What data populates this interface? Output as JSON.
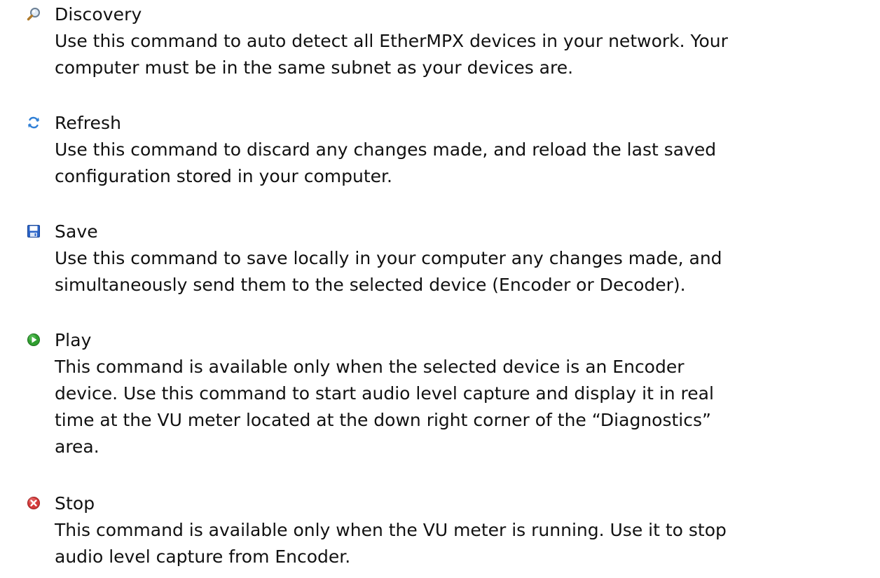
{
  "commands": [
    {
      "icon": "magnifier-icon",
      "title": "Discovery",
      "lines": [
        "Use this command to auto detect all EtherMPX devices in your network. Your",
        "computer must be in the same subnet as your devices are."
      ]
    },
    {
      "icon": "refresh-icon",
      "title": "Refresh",
      "lines": [
        "Use this command to discard any changes made, and reload the last saved",
        "configuration stored in your computer."
      ]
    },
    {
      "icon": "floppy-disk-icon",
      "title": "Save",
      "lines": [
        "Use this command to save locally in your computer any changes made, and",
        "simultaneously send them to the selected device (Encoder or Decoder)."
      ]
    },
    {
      "icon": "play-icon",
      "title": "Play",
      "lines": [
        "This command is available only when the selected device is an Encoder",
        "device. Use this command to start audio level capture and display it in real",
        "time at the VU meter located at the down right corner of the “Diagnostics”",
        "area."
      ]
    },
    {
      "icon": "stop-icon",
      "title": "Stop",
      "lines": [
        "This command is available only when the VU meter is running. Use it to stop",
        "audio level capture from Encoder."
      ]
    }
  ],
  "colors": {
    "text": "#111111",
    "play_green": "#2f9e2f",
    "stop_red": "#d43a3a",
    "save_blue": "#2a63c7",
    "refresh_blue": "#2f7fd6"
  }
}
